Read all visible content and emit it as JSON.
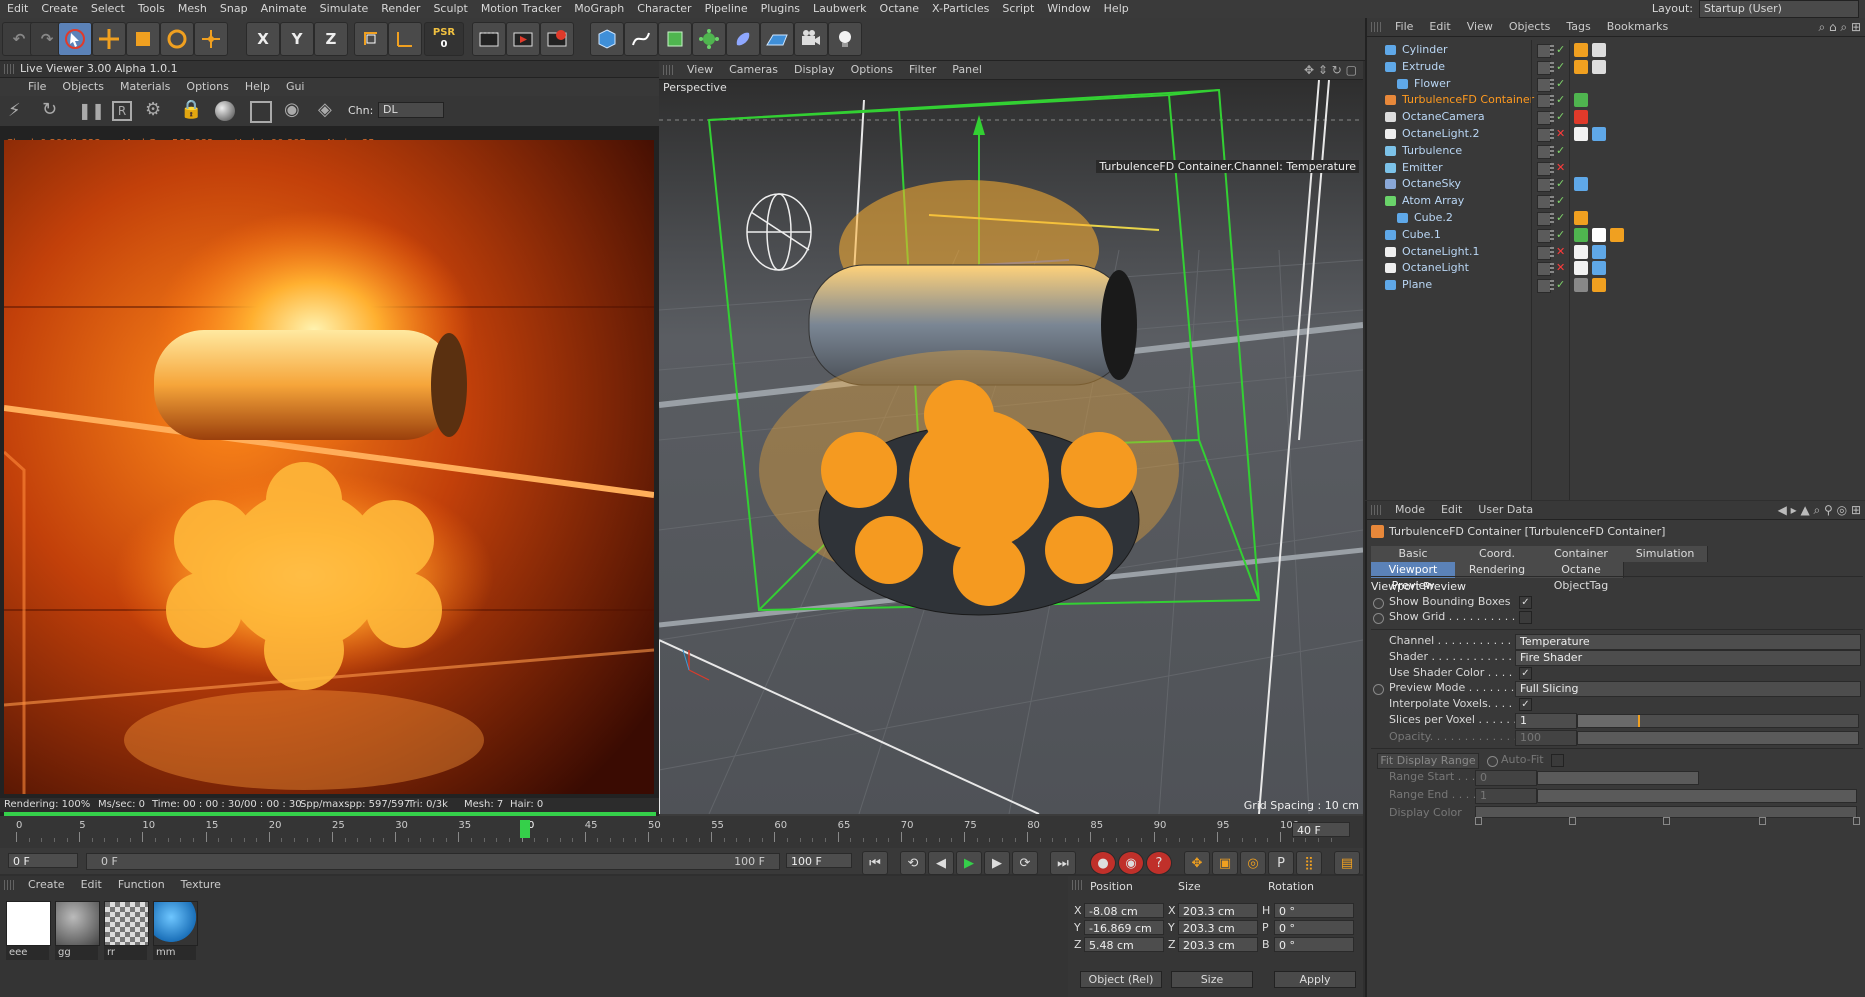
{
  "menu": [
    "Edit",
    "Create",
    "Select",
    "Tools",
    "Mesh",
    "Snap",
    "Animate",
    "Simulate",
    "Render",
    "Sculpt",
    "Motion Tracker",
    "MoGraph",
    "Character",
    "Pipeline",
    "Plugins",
    "Laubwerk",
    "Octane",
    "X-Particles",
    "Script",
    "Window",
    "Help"
  ],
  "layout": {
    "label": "Layout:",
    "value": "Startup (User)"
  },
  "toolbar": {
    "x": "X",
    "y": "Y",
    "z": "Z",
    "psr_top": "PSR",
    "psr_bottom": "0"
  },
  "live_viewer": {
    "title": "Live Viewer 3.00 Alpha 1.0.1",
    "menu": [
      "File",
      "Objects",
      "Materials",
      "Options",
      "Help",
      "Gui"
    ],
    "chn_label": "Chn:",
    "chn_value": "DL",
    "stats": "Check:0.291/1.223ms. MeshGen:565.083ms. Update90.807ms. Nodes:35",
    "status": {
      "rendering": "Rendering: 100%",
      "ms": "Ms/sec: 0",
      "time": "Time: 00 : 00 : 30/00 : 00 : 30",
      "spp": "Spp/maxspp: 597/597",
      "tri": "Tri: 0/3k",
      "mesh": "Mesh: 7",
      "hair": "Hair: 0"
    }
  },
  "viewport": {
    "menu": [
      "View",
      "Cameras",
      "Display",
      "Options",
      "Filter",
      "Panel"
    ],
    "label": "Perspective",
    "info": "TurbulenceFD Container.Channel: Temperature",
    "grid": "Grid Spacing : 10 cm"
  },
  "objects": {
    "menu": [
      "File",
      "Edit",
      "View",
      "Objects",
      "Tags",
      "Bookmarks"
    ],
    "items": [
      {
        "name": "Cylinder",
        "color": "#5fa8e8"
      },
      {
        "name": "Extrude",
        "color": "#5fa8e8"
      },
      {
        "name": "Flower",
        "color": "#5fa8e8"
      },
      {
        "name": "TurbulenceFD Container",
        "color": "#e8883a"
      },
      {
        "name": "OctaneCamera",
        "color": "#dddddd"
      },
      {
        "name": "OctaneLight.2",
        "color": "#eeeeee"
      },
      {
        "name": "Turbulence",
        "color": "#7cc2e8"
      },
      {
        "name": "Emitter",
        "color": "#7cc2e8"
      },
      {
        "name": "OctaneSky",
        "color": "#8aa8d8"
      },
      {
        "name": "Atom Array",
        "color": "#6ad36a"
      },
      {
        "name": "Cube.2",
        "color": "#5fa8e8"
      },
      {
        "name": "Cube.1",
        "color": "#5fa8e8"
      },
      {
        "name": "OctaneLight.1",
        "color": "#eeeeee"
      },
      {
        "name": "OctaneLight",
        "color": "#eeeeee"
      },
      {
        "name": "Plane",
        "color": "#5fa8e8"
      }
    ]
  },
  "attributes": {
    "menu": [
      "Mode",
      "Edit",
      "User Data"
    ],
    "title": "TurbulenceFD Container [TurbulenceFD Container]",
    "tabs_row1": [
      "Basic",
      "Coord.",
      "Container",
      "Simulation"
    ],
    "tabs_row2": [
      "Viewport Preview",
      "Rendering",
      "Octane ObjectTag"
    ],
    "section": "Viewport Preview",
    "show_bounding_boxes": "Show Bounding Boxes",
    "show_grid": "Show Grid . . . . . . . . . .",
    "channel_label": "Channel . . . . . . . . . . . .",
    "channel_value": "Temperature",
    "shader_label": "Shader . . . . . . . . . . . . .",
    "shader_value": "Fire Shader",
    "use_shader_color": "Use Shader Color . . . .",
    "preview_mode_label": "Preview Mode . . . . . . .",
    "preview_mode_value": "Full Slicing",
    "interpolate": "Interpolate Voxels. . . .",
    "slices_label": "Slices per Voxel . . . . . .",
    "slices_value": "1",
    "opacity_label": "Opacity. . . . . . . . . . . . .",
    "opacity_value": "100",
    "fit_range": "Fit Display Range",
    "auto_fit": "Auto-Fit",
    "range_start_label": "Range Start . . . .",
    "range_start_value": "0",
    "range_end_label": "Range End . . . . .",
    "range_end_value": "1",
    "display_color": "Display Color"
  },
  "timeline": {
    "ticks": [
      "0",
      "5",
      "10",
      "15",
      "20",
      "25",
      "30",
      "35",
      "40",
      "45",
      "50",
      "55",
      "60",
      "65",
      "70",
      "75",
      "80",
      "85",
      "90",
      "95",
      "100"
    ],
    "current": "40",
    "end_field": "40 F",
    "start_field": "0 F",
    "range_start": "0 F",
    "range_end": "100 F",
    "max_field": "100 F"
  },
  "materials": {
    "menu": [
      "Create",
      "Edit",
      "Function",
      "Texture"
    ],
    "items": [
      {
        "name": "eee",
        "color": "#ffffff"
      },
      {
        "name": "gg",
        "color": "#7a7a7a"
      },
      {
        "name": "rr",
        "color": "#bdbdbd"
      },
      {
        "name": "mm",
        "color": "#2b8fd8"
      }
    ]
  },
  "coords": {
    "headers": [
      "Position",
      "Size",
      "Rotation"
    ],
    "rows": [
      {
        "axis": "X",
        "pos": "-8.08 cm",
        "saxis": "X",
        "size": "203.3 cm",
        "raxis": "H",
        "rot": "0 °"
      },
      {
        "axis": "Y",
        "pos": "-16.869 cm",
        "saxis": "Y",
        "size": "203.3 cm",
        "raxis": "P",
        "rot": "0 °"
      },
      {
        "axis": "Z",
        "pos": "5.48 cm",
        "saxis": "Z",
        "size": "203.3 cm",
        "raxis": "B",
        "rot": "0 °"
      }
    ],
    "mode": "Object (Rel)",
    "size_mode": "Size",
    "apply": "Apply"
  }
}
